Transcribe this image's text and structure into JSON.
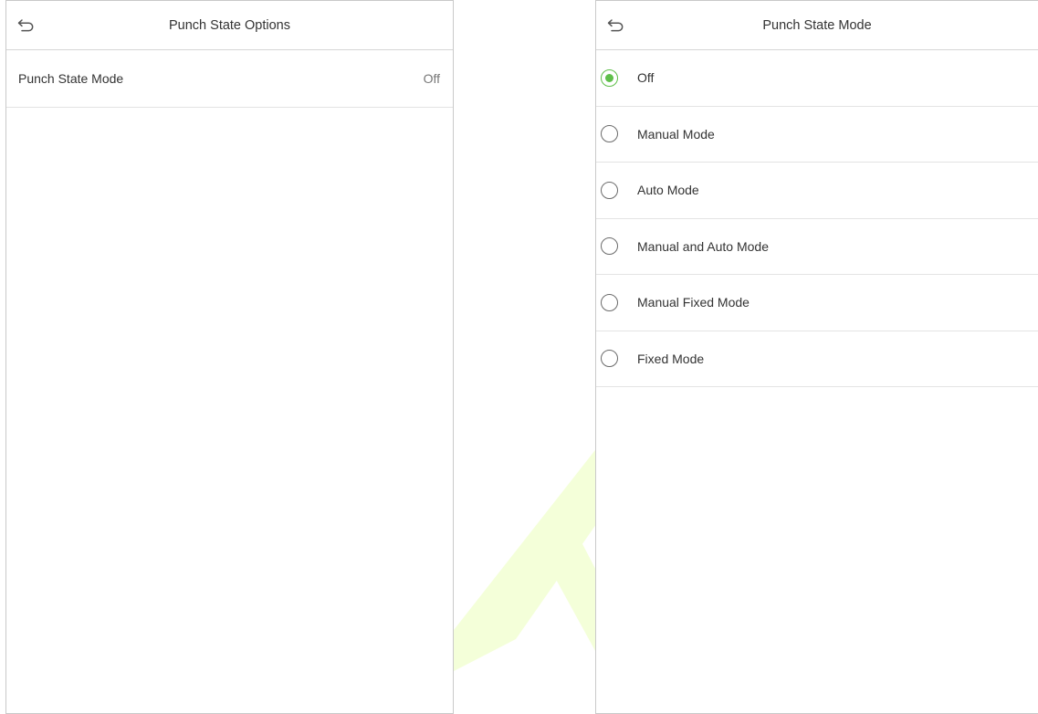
{
  "left_screen": {
    "title": "Punch State Options",
    "back_icon": "back-arrow-icon",
    "rows": [
      {
        "label": "Punch State Mode",
        "value": "Off"
      }
    ]
  },
  "right_screen": {
    "title": "Punch State Mode",
    "back_icon": "back-arrow-icon",
    "options": [
      {
        "label": "Off",
        "selected": true
      },
      {
        "label": "Manual Mode",
        "selected": false
      },
      {
        "label": "Auto Mode",
        "selected": false
      },
      {
        "label": "Manual and Auto Mode",
        "selected": false
      },
      {
        "label": "Manual Fixed Mode",
        "selected": false
      },
      {
        "label": "Fixed Mode",
        "selected": false
      }
    ]
  },
  "colors": {
    "accent": "#5fbf4a",
    "watermark": "#f4ffd9"
  }
}
